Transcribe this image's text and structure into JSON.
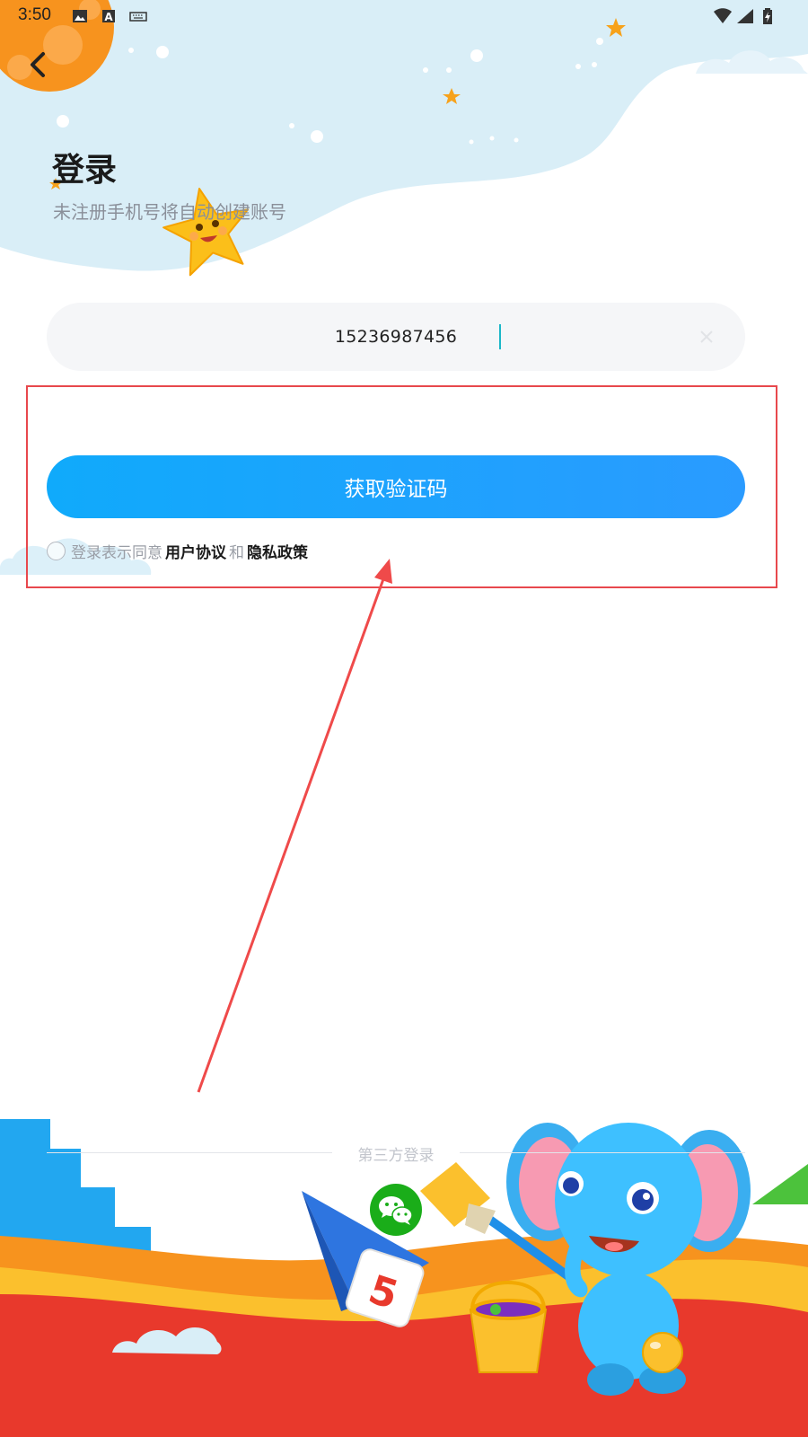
{
  "status_bar": {
    "time": "3:50",
    "icons": [
      "image-icon",
      "text-a-icon",
      "keyboard-icon",
      "wifi-icon",
      "signal-icon",
      "battery-icon"
    ]
  },
  "header": {
    "back_icon": "chevron-left-icon",
    "title": "登录",
    "subtitle": "未注册手机号将自动创建账号"
  },
  "form": {
    "phone_value": "15236987456",
    "clear_icon": "close-icon",
    "get_code_label": "获取验证码",
    "agreement": {
      "prefix": "登录表示同意",
      "user_agreement": "用户协议",
      "and": "和",
      "privacy_policy": "隐私政策",
      "checked": false
    }
  },
  "third_party": {
    "label": "第三方登录",
    "providers": [
      "wechat-icon"
    ]
  },
  "colors": {
    "primary_button": "#18a8fd",
    "highlight": "#e8484d",
    "wechat": "#1aad19",
    "title": "#1a1a1a",
    "subtitle": "#8a8f99"
  }
}
